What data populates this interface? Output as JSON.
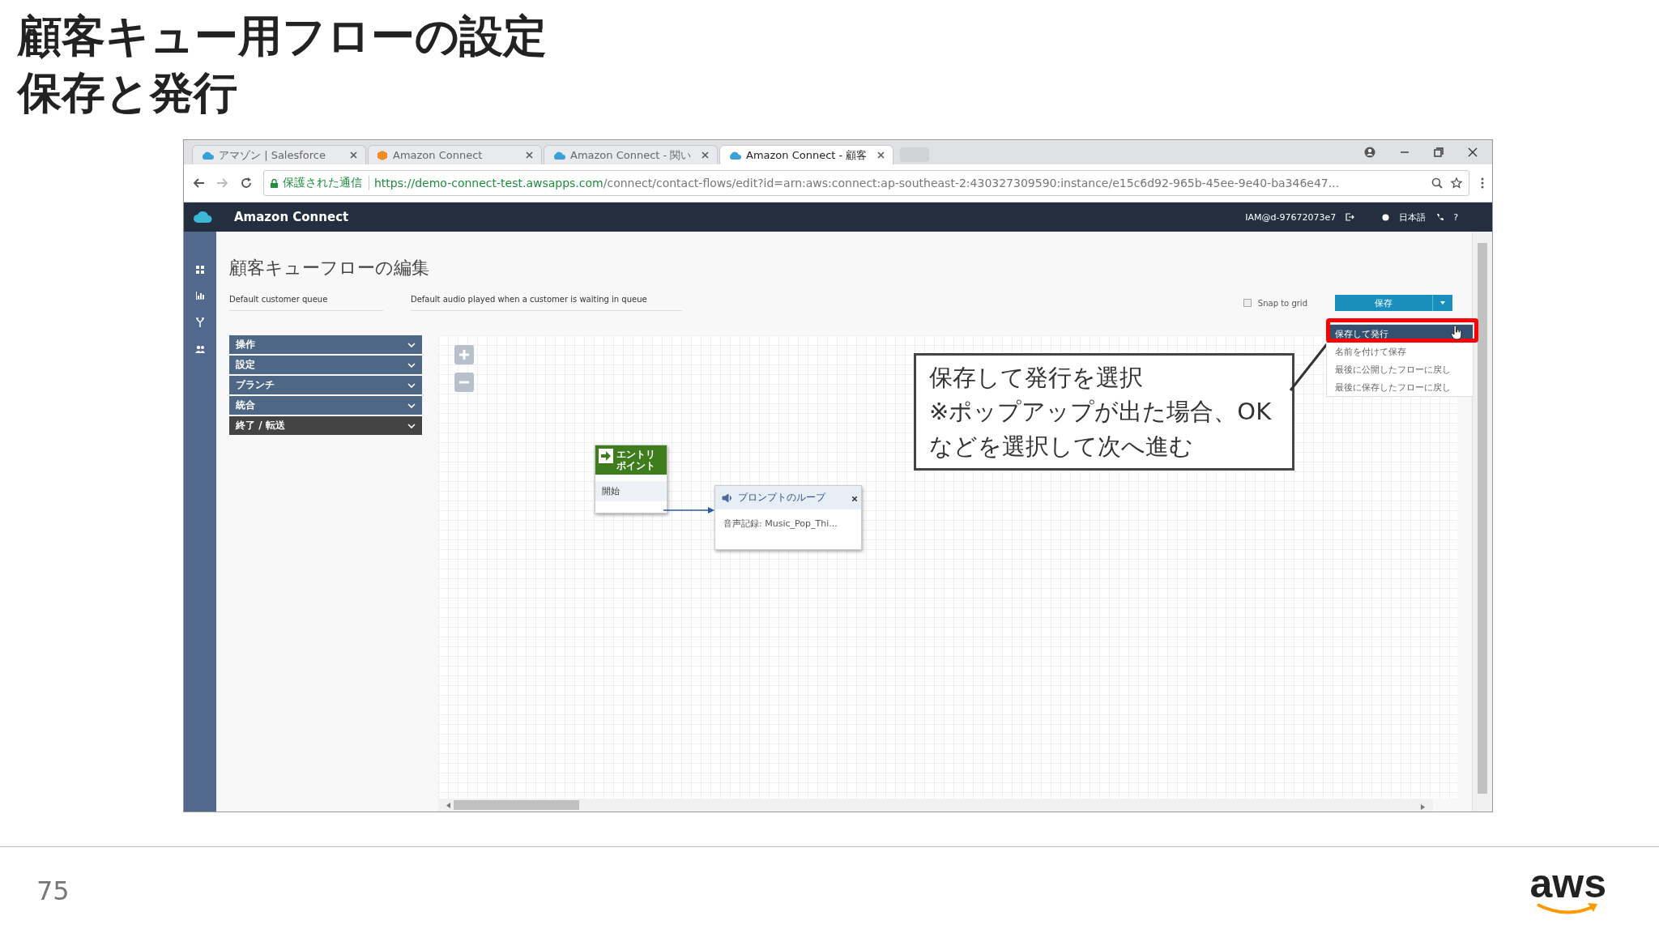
{
  "slide": {
    "title_lines": [
      "顧客キュー用フローの設定",
      "保存と発行"
    ],
    "page_number": "75",
    "logo_text": "aws"
  },
  "browser": {
    "tabs": [
      {
        "label": "アマゾン | Salesforce",
        "selected": false
      },
      {
        "label": "Amazon Connect",
        "selected": false
      },
      {
        "label": "Amazon Connect - 関い",
        "selected": false
      },
      {
        "label": "Amazon Connect - 顧客",
        "selected": true
      }
    ],
    "secure_label": "保護された通信",
    "url_host": "https://demo-connect-test.awsapps.com",
    "url_path": "/connect/contact-flows/edit?id=arn:aws:connect:ap-southeast-2:430327309590:instance/e15c6d92-965b-45ee-9e40-ba346e47..."
  },
  "app": {
    "brand": "Amazon Connect",
    "user": "IAM@d-97672073e7",
    "language": "日本語",
    "help": "?"
  },
  "editor": {
    "title": "顧客キューフローの編集",
    "fields": [
      {
        "label": "Default customer queue"
      },
      {
        "label": "Default audio played when a customer is waiting in queue"
      }
    ],
    "snap_to_grid": {
      "label": "Snap to grid",
      "checked": false
    },
    "save_button": "保存",
    "save_menu": [
      {
        "label": "保存して発行",
        "selected": true
      },
      {
        "label": "名前を付けて保存",
        "selected": false
      },
      {
        "label": "最後に公開したフローに戻し",
        "selected": false
      },
      {
        "label": "最後に保存したフローに戻し",
        "selected": false
      }
    ],
    "palette": [
      {
        "label": "操作",
        "selected": false
      },
      {
        "label": "設定",
        "selected": false
      },
      {
        "label": "ブランチ",
        "selected": false
      },
      {
        "label": "統合",
        "selected": false
      },
      {
        "label": "終了 / 転送",
        "selected": true
      }
    ]
  },
  "flow": {
    "nodes": [
      {
        "kind": "entry",
        "title": "エントリポイント",
        "output": "開始"
      },
      {
        "kind": "prompt",
        "title": "プロンプトのループ",
        "detail": "音声記録: Music_Pop_Thi..."
      }
    ]
  },
  "callout": {
    "lines": [
      "保存して発行を選択",
      "※ポップアップが出た場合、OK",
      "などを選択して次へ進む"
    ]
  }
}
